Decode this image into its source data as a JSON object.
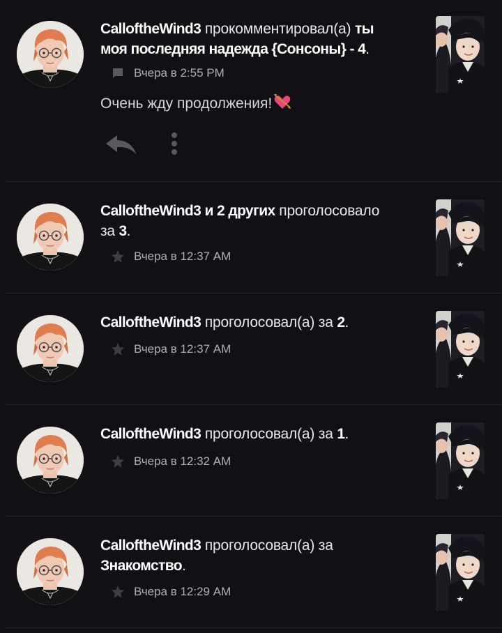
{
  "notifications": [
    {
      "actor": "CalloftheWind3",
      "action": " прокомментировал(а) ",
      "target_line1": "ты",
      "target_line2": "моя последняя надежда {Сонсоны} - 4",
      "suffix": ".",
      "time": "Вчера в 2:55 PM",
      "icon": "comment-icon",
      "comment": "Очень жду продолжения!",
      "comment_emoji": "heart-arrow-emoji"
    },
    {
      "actor": "CalloftheWind3",
      "others": " и 2 других",
      "action_line1": " проголосовало",
      "action_line2": "за ",
      "target": "3",
      "suffix": ".",
      "time": "Вчера в 12:37 AM",
      "icon": "star-icon"
    },
    {
      "actor": "CalloftheWind3",
      "action": " проголосовал(а) за ",
      "target": "2",
      "suffix": ".",
      "time": "Вчера в 12:37 AM",
      "icon": "star-icon"
    },
    {
      "actor": "CalloftheWind3",
      "action": " проголосовал(а) за ",
      "target": "1",
      "suffix": ".",
      "time": "Вчера в 12:32 AM",
      "icon": "star-icon"
    },
    {
      "actor": "CalloftheWind3",
      "action_line1": " проголосовал(а) за",
      "target": "Знакомство",
      "suffix": ".",
      "time": "Вчера в 12:29 AM",
      "icon": "star-icon"
    }
  ],
  "colors": {
    "background": "#121015",
    "divider": "#2c2a30",
    "text": "#e9e8ea",
    "meta": "#b2b0b6",
    "icon": "#5b5960"
  }
}
